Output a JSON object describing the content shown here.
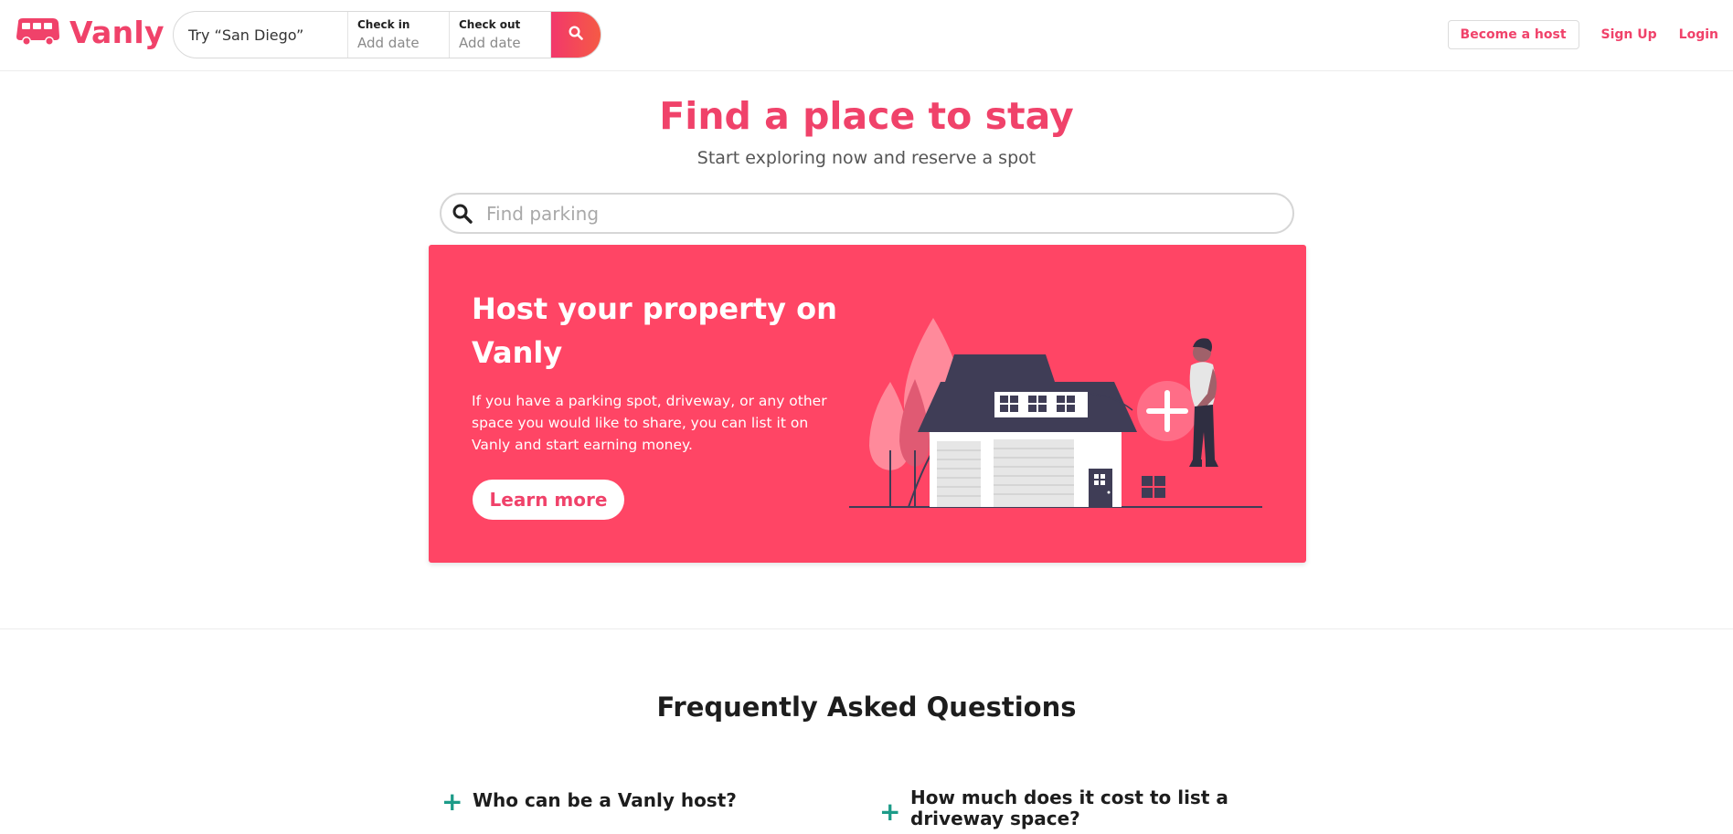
{
  "brand": {
    "name": "Vanly",
    "color": "#f0426a"
  },
  "topnav": {
    "search": {
      "location_placeholder": "Try “San Diego”",
      "checkin_label": "Check in",
      "checkin_value": "Add date",
      "checkout_label": "Check out",
      "checkout_value": "Add date"
    },
    "become_host": "Become a host",
    "signup": "Sign Up",
    "login": "Login"
  },
  "hero": {
    "title": "Find a place to stay",
    "subtitle": "Start exploring now and reserve a spot",
    "search_placeholder": "Find parking"
  },
  "host_card": {
    "title": "Host your property on Vanly",
    "text": "If you have a parking spot, driveway, or any other space you would like to share, you can list it on Vanly and start earning money.",
    "button": "Learn more",
    "background": "#ff4565"
  },
  "faq": {
    "title": "Frequently Asked Questions",
    "accent": "#1c9b88",
    "items": [
      {
        "question": "Who can be a Vanly host?"
      },
      {
        "question": "How much does it cost to list a driveway space?"
      }
    ]
  },
  "icons": [
    "van-icon",
    "search-icon",
    "plus-icon",
    "house-illustration"
  ]
}
